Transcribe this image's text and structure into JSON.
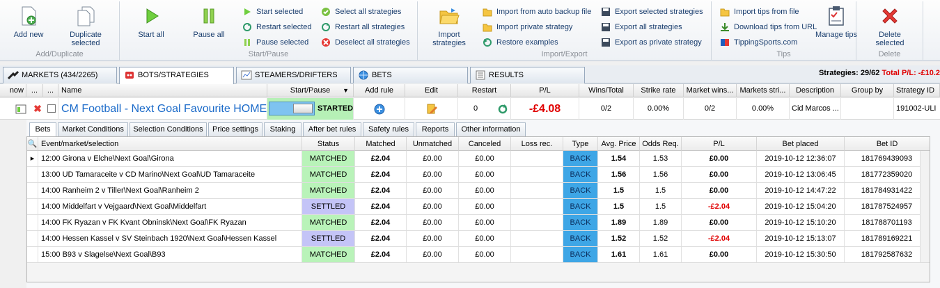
{
  "ribbon": {
    "groups": [
      {
        "caption": "Add/Duplicate",
        "buttons": [
          {
            "label": "Add new",
            "icon": "add-doc-icon"
          },
          {
            "label": "Duplicate selected",
            "icon": "duplicate-doc-icon"
          }
        ]
      },
      {
        "caption": "Start/Pause",
        "buttons": [
          {
            "label": "Start all",
            "icon": "play-icon"
          },
          {
            "label": "Pause all",
            "icon": "pause-icon"
          }
        ],
        "small": [
          "Start selected",
          "Restart selected",
          "Pause selected",
          "Select all strategies",
          "Restart all strategies",
          "Deselect all strategies"
        ]
      },
      {
        "caption": "Import/Export",
        "buttons": [
          {
            "label": "Import strategies",
            "icon": "folder-open-icon"
          }
        ],
        "small": [
          "Import from auto backup file",
          "Import private strategy",
          "Restore examples",
          "Export selected strategies",
          "Export all strategies",
          "Export as private strategy"
        ]
      },
      {
        "caption": "Tips",
        "buttons": [
          {
            "label": "Manage tips",
            "icon": "clipboard-icon"
          }
        ],
        "small": [
          "Import tips from file",
          "Download tips from URL",
          "TippingSports.com"
        ]
      },
      {
        "caption": "Delete",
        "buttons": [
          {
            "label": "Delete selected",
            "icon": "delete-x-icon"
          }
        ]
      }
    ]
  },
  "tabs": [
    {
      "label": "MARKETS (434/2265)",
      "icon": "markets-icon"
    },
    {
      "label": "BOTS/STRATEGIES",
      "icon": "bots-icon"
    },
    {
      "label": "STEAMERS/DRIFTERS",
      "icon": "chart-icon"
    },
    {
      "label": "BETS",
      "icon": "globe-icon"
    },
    {
      "label": "RESULTS",
      "icon": "results-icon"
    }
  ],
  "summary": {
    "strategies": "Strategies: 29/62",
    "total_pl": "Total P/L: -£10.2"
  },
  "strategy_headers": [
    "now",
    "...",
    "...",
    "Name",
    "Start/Pause",
    "Add rule",
    "Edit",
    "Restart",
    "P/L",
    "Wins/Total",
    "Strike rate",
    "Market wins...",
    "Markets stri...",
    "Description",
    "Group by",
    "Strategy ID"
  ],
  "strategy": {
    "name": "CM Football - Next Goal Favourite HOME",
    "status": "STARTED",
    "restart_count": "0",
    "pl": "-£4.08",
    "wins_total": "0/2",
    "strike_rate": "0.00%",
    "market_wins": "0/2",
    "market_strike": "0.00%",
    "description": "Cid Marcos ...",
    "group_by": "",
    "strategy_id": "191002-ULI"
  },
  "detail_tabs": [
    "Bets",
    "Market Conditions",
    "Selection Conditions",
    "Price settings",
    "Staking",
    "After bet rules",
    "Safety rules",
    "Reports",
    "Other information"
  ],
  "bets_headers": [
    "Event/market/selection",
    "Status",
    "Matched",
    "Unmatched",
    "Canceled",
    "Loss rec.",
    "Type",
    "Avg. Price",
    "Odds Req.",
    "P/L",
    "Bet placed",
    "Bet ID"
  ],
  "bets": [
    {
      "event": "12:00 Girona v Elche\\Next Goal\\Girona",
      "status": "MATCHED",
      "matched": "£2.04",
      "unmatched": "£0.00",
      "canceled": "£0.00",
      "loss": "",
      "type": "BACK",
      "avg": "1.54",
      "odds": "1.53",
      "pl": "£0.00",
      "placed": "2019-10-12 12:36:07",
      "id": "181769439093"
    },
    {
      "event": "13:00 UD Tamaraceite v CD Marino\\Next Goal\\UD Tamaraceite",
      "status": "MATCHED",
      "matched": "£2.04",
      "unmatched": "£0.00",
      "canceled": "£0.00",
      "loss": "",
      "type": "BACK",
      "avg": "1.56",
      "odds": "1.56",
      "pl": "£0.00",
      "placed": "2019-10-12 13:06:45",
      "id": "181772359020"
    },
    {
      "event": "14:00 Ranheim 2 v Tiller\\Next Goal\\Ranheim 2",
      "status": "MATCHED",
      "matched": "£2.04",
      "unmatched": "£0.00",
      "canceled": "£0.00",
      "loss": "",
      "type": "BACK",
      "avg": "1.5",
      "odds": "1.5",
      "pl": "£0.00",
      "placed": "2019-10-12 14:47:22",
      "id": "181784931422"
    },
    {
      "event": "14:00 Middelfart v Vejgaard\\Next Goal\\Middelfart",
      "status": "SETTLED",
      "matched": "£2.04",
      "unmatched": "£0.00",
      "canceled": "£0.00",
      "loss": "",
      "type": "BACK",
      "avg": "1.5",
      "odds": "1.5",
      "pl": "-£2.04",
      "placed": "2019-10-12 15:04:20",
      "id": "181787524957"
    },
    {
      "event": "14:00 FK Ryazan v FK Kvant Obninsk\\Next Goal\\FK Ryazan",
      "status": "MATCHED",
      "matched": "£2.04",
      "unmatched": "£0.00",
      "canceled": "£0.00",
      "loss": "",
      "type": "BACK",
      "avg": "1.89",
      "odds": "1.89",
      "pl": "£0.00",
      "placed": "2019-10-12 15:10:20",
      "id": "181788701193"
    },
    {
      "event": "14:00 Hessen Kassel v SV Steinbach 1920\\Next Goal\\Hessen Kassel",
      "status": "SETTLED",
      "matched": "£2.04",
      "unmatched": "£0.00",
      "canceled": "£0.00",
      "loss": "",
      "type": "BACK",
      "avg": "1.52",
      "odds": "1.52",
      "pl": "-£2.04",
      "placed": "2019-10-12 15:13:07",
      "id": "181789169221"
    },
    {
      "event": "15:00 B93 v Slagelse\\Next Goal\\B93",
      "status": "MATCHED",
      "matched": "£2.04",
      "unmatched": "£0.00",
      "canceled": "£0.00",
      "loss": "",
      "type": "BACK",
      "avg": "1.61",
      "odds": "1.61",
      "pl": "£0.00",
      "placed": "2019-10-12 15:30:50",
      "id": "181792587632"
    }
  ]
}
